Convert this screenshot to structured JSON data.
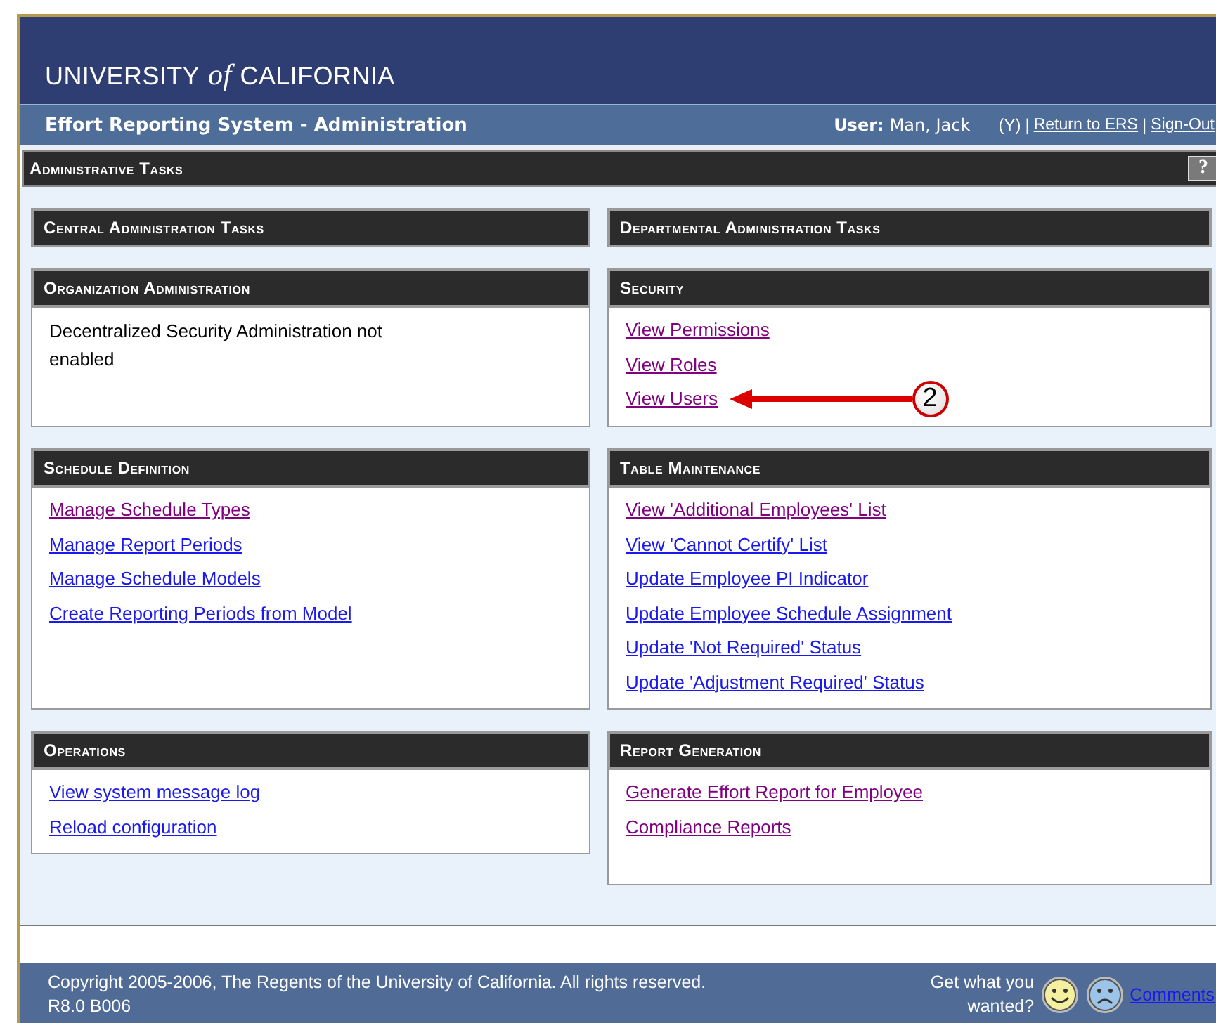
{
  "header": {
    "logo_prefix": "UNIVERSITY",
    "logo_of": "of",
    "logo_suffix": "CALIFORNIA"
  },
  "subheader": {
    "title": "Effort Reporting System - Administration",
    "user_label": "User:",
    "user_name": "Man, Jack",
    "user_flag": "(Y)",
    "links": [
      {
        "separator": "|",
        "label": "Return to ERS"
      },
      {
        "separator": "|",
        "label": "Sign-Out"
      }
    ]
  },
  "section_bar": {
    "title": "Administrative Tasks",
    "help": "?"
  },
  "columns": [
    {
      "title": "Central Administration Tasks",
      "panels": [
        {
          "title": "Organization Administration",
          "kind": "text",
          "text": "Decentralized Security Administration not enabled"
        },
        {
          "title": "Schedule Definition",
          "kind": "links",
          "links": [
            {
              "label": "Manage Schedule Types",
              "visited": true
            },
            {
              "label": "Manage Report Periods",
              "visited": false
            },
            {
              "label": "Manage Schedule Models",
              "visited": false
            },
            {
              "label": "Create Reporting Periods from Model",
              "visited": false
            }
          ]
        },
        {
          "title": "Operations",
          "kind": "links",
          "links": [
            {
              "label": "View system message log",
              "visited": false
            },
            {
              "label": "Reload configuration",
              "visited": false
            }
          ]
        }
      ]
    },
    {
      "title": "Departmental Administration Tasks",
      "panels": [
        {
          "title": "Security",
          "kind": "links",
          "links": [
            {
              "label": "View Permissions",
              "visited": true
            },
            {
              "label": "View Roles",
              "visited": true
            },
            {
              "label": "View Users",
              "visited": true,
              "callout": "2"
            }
          ]
        },
        {
          "title": "Table Maintenance",
          "kind": "links",
          "links": [
            {
              "label": "View 'Additional Employees' List",
              "visited": true
            },
            {
              "label": "View 'Cannot Certify' List",
              "visited": false
            },
            {
              "label": "Update Employee PI Indicator",
              "visited": false
            },
            {
              "label": "Update Employee Schedule Assignment",
              "visited": false
            },
            {
              "label": "Update 'Not Required' Status",
              "visited": false
            },
            {
              "label": "Update 'Adjustment Required' Status",
              "visited": false
            }
          ]
        },
        {
          "title": "Report Generation",
          "kind": "links",
          "links": [
            {
              "label": "Generate Effort Report for Employee",
              "visited": true
            },
            {
              "label": "Compliance Reports",
              "visited": true
            }
          ]
        }
      ]
    }
  ],
  "footer": {
    "copyright": "Copyright 2005-2006, The Regents of the University of California. All rights reserved.",
    "version": "R8.0 B006",
    "feedback_prompt": "Get what you wanted?",
    "comments_link": "Comments"
  }
}
